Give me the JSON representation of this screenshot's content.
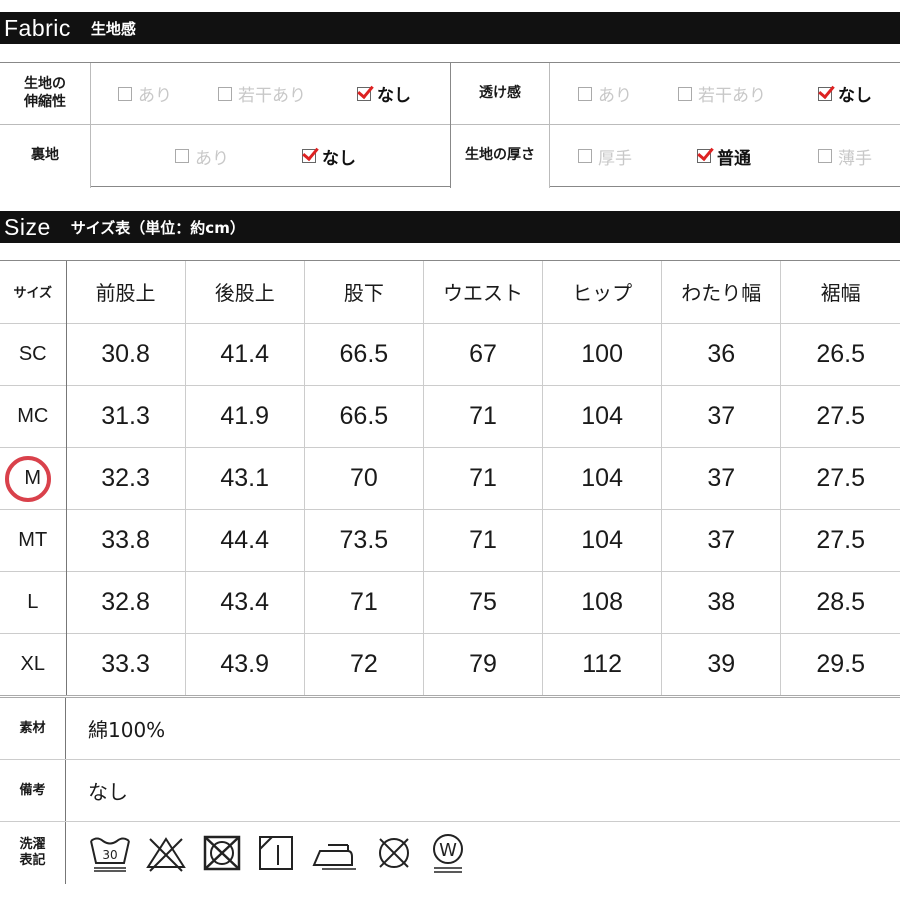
{
  "fabric": {
    "title": "Fabric",
    "subtitle": "生地感",
    "rows": [
      {
        "left": {
          "label": "生地の\n伸縮性",
          "options": [
            {
              "text": "あり",
              "checked": false
            },
            {
              "text": "若干あり",
              "checked": false
            },
            {
              "text": "なし",
              "checked": true
            }
          ]
        },
        "right": {
          "label": "透け感",
          "options": [
            {
              "text": "あり",
              "checked": false
            },
            {
              "text": "若干あり",
              "checked": false
            },
            {
              "text": "なし",
              "checked": true
            }
          ]
        }
      },
      {
        "left": {
          "label": "裏地",
          "options": [
            {
              "text": "あり",
              "checked": false
            },
            {
              "text": "なし",
              "checked": true
            }
          ]
        },
        "right": {
          "label": "生地の厚さ",
          "options": [
            {
              "text": "厚手",
              "checked": false
            },
            {
              "text": "普通",
              "checked": true
            },
            {
              "text": "薄手",
              "checked": false
            }
          ]
        }
      }
    ]
  },
  "size": {
    "title": "Size",
    "subtitle": "サイズ表（単位：約cm）",
    "headers": [
      "サイズ",
      "前股上",
      "後股上",
      "股下",
      "ウエスト",
      "ヒップ",
      "わたり幅",
      "裾幅"
    ],
    "rows": [
      [
        "SC",
        "30.8",
        "41.4",
        "66.5",
        "67",
        "100",
        "36",
        "26.5"
      ],
      [
        "MC",
        "31.3",
        "41.9",
        "66.5",
        "71",
        "104",
        "37",
        "27.5"
      ],
      [
        "M",
        "32.3",
        "43.1",
        "70",
        "71",
        "104",
        "37",
        "27.5"
      ],
      [
        "MT",
        "33.8",
        "44.4",
        "73.5",
        "71",
        "104",
        "37",
        "27.5"
      ],
      [
        "L",
        "32.8",
        "43.4",
        "71",
        "75",
        "108",
        "38",
        "28.5"
      ],
      [
        "XL",
        "33.3",
        "43.9",
        "72",
        "79",
        "112",
        "39",
        "29.5"
      ]
    ],
    "highlighted_size": "M",
    "highlight_color": "#d9414b"
  },
  "info": {
    "material_label": "素材",
    "material_value": "綿100%",
    "note_label": "備考",
    "note_value": "なし",
    "care_label": "洗濯\n表記",
    "care_icons": [
      {
        "name": "wash-30-icon",
        "text": "30"
      },
      {
        "name": "no-bleach-icon"
      },
      {
        "name": "no-tumble-dry-icon"
      },
      {
        "name": "line-dry-shade-icon"
      },
      {
        "name": "iron-low-icon"
      },
      {
        "name": "no-dry-clean-icon"
      },
      {
        "name": "wet-clean-icon",
        "text": "W"
      }
    ]
  },
  "accent_check_color": "#dd2222"
}
